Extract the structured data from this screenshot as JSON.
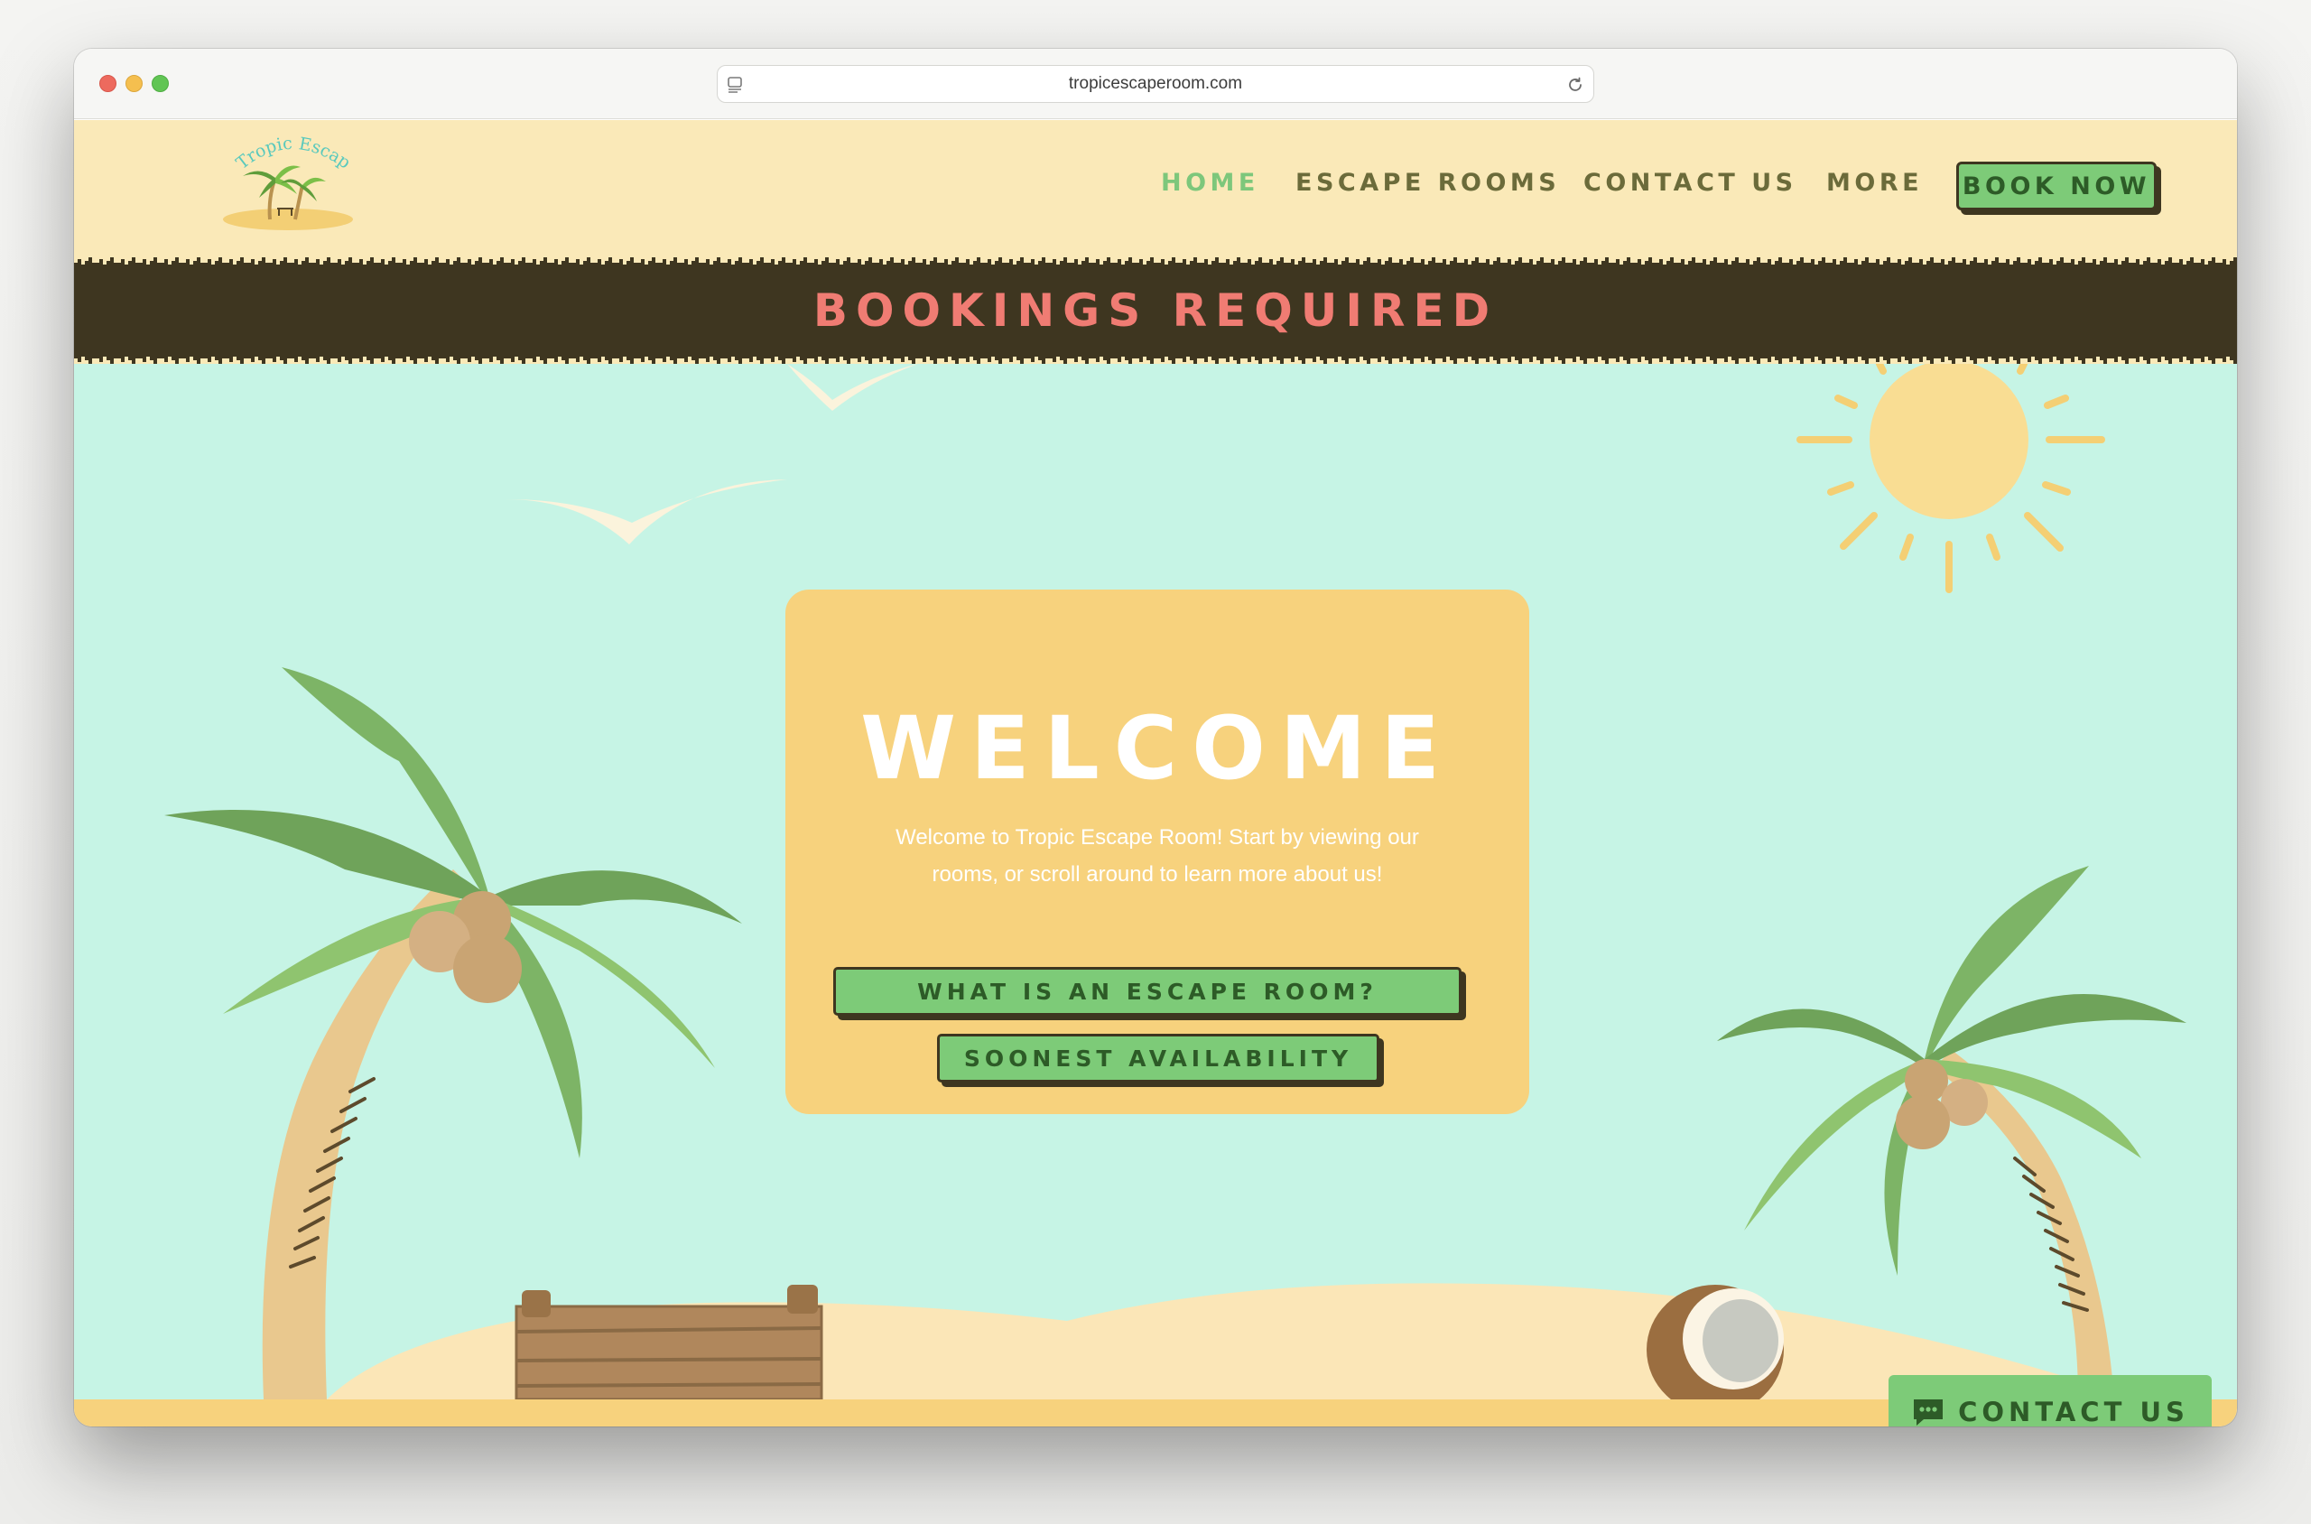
{
  "browser": {
    "url": "tropicescaperoom.com"
  },
  "site": {
    "logo_text": "Tropic Escape",
    "nav": {
      "home": "HOME",
      "escape_rooms": "ESCAPE ROOMS",
      "contact_us": "CONTACT US",
      "more": "MORE",
      "book_now": "BOOK NOW",
      "active": "HOME"
    },
    "banner": "BOOKINGS REQUIRED",
    "welcome": {
      "title": "WELCOME",
      "text": "Welcome to Tropic Escape Room! Start by viewing our rooms, or scroll around to learn more about us!",
      "btn_what": "WHAT IS AN ESCAPE ROOM?",
      "btn_soonest": "SOONEST AVAILABILITY"
    },
    "contact_float": "CONTACT US"
  },
  "colors": {
    "header_bg": "#fae9b8",
    "banner_bg": "#3e3620",
    "banner_text": "#f07c73",
    "sky": "#c6f4e5",
    "card": "#f7d27d",
    "button_green": "#7dcb78",
    "nav_active": "#7dc77b",
    "nav_text": "#6b6b3a"
  },
  "icons": {
    "url_page": "page-icon",
    "url_reload": "reload-icon",
    "chat": "chat-bubble-icon"
  }
}
